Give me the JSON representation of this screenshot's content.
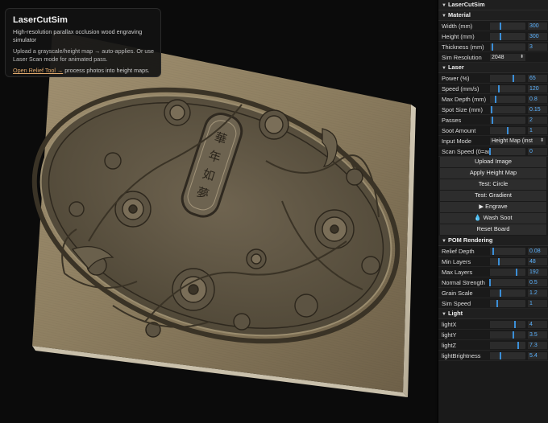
{
  "info": {
    "title": "LaserCutSim",
    "desc": "High-resolution parallax occlusion wood engraving simulator",
    "hint": "Upload a grayscale/height map → auto-applies. Or use Laser Scan mode for animated pass.",
    "link_label": "Open Relief Tool →",
    "link_suffix": " process photos into height maps."
  },
  "board": {
    "emblem_text": "華年如夢"
  },
  "gui": {
    "title": "LaserCutSim",
    "sections": [
      {
        "id": "material",
        "title": "Material",
        "rows": [
          {
            "label": "Width (mm)",
            "value": "300",
            "frac": 0.3
          },
          {
            "label": "Height (mm)",
            "value": "300",
            "frac": 0.3
          },
          {
            "label": "Thickness (mm)",
            "value": "3",
            "frac": 0.07
          },
          {
            "label": "Sim Resolution",
            "select": "2048"
          }
        ]
      },
      {
        "id": "laser",
        "title": "Laser",
        "rows": [
          {
            "label": "Power (%)",
            "value": "65",
            "frac": 0.65
          },
          {
            "label": "Speed (mm/s)",
            "value": "120",
            "frac": 0.24
          },
          {
            "label": "Max Depth (mm)",
            "value": "0.8",
            "frac": 0.15
          },
          {
            "label": "Spot Size (mm)",
            "value": "0.15",
            "frac": 0.05
          },
          {
            "label": "Passes",
            "value": "2",
            "frac": 0.06
          },
          {
            "label": "Soot Amount",
            "value": "1",
            "frac": 0.5
          },
          {
            "label": "Input Mode",
            "select": "Height Map (inst"
          },
          {
            "label": "Scan Speed (0=auto)",
            "value": "0",
            "frac": 0.0
          }
        ],
        "buttons": [
          "Upload Image",
          "Apply Height Map",
          "Test: Circle",
          "Test: Gradient",
          "▶ Engrave",
          "💧 Wash Soot",
          "Reset Board"
        ]
      },
      {
        "id": "pom",
        "title": "POM Rendering",
        "rows": [
          {
            "label": "Relief Depth",
            "value": "0.08",
            "frac": 0.08
          },
          {
            "label": "Min Layers",
            "value": "48",
            "frac": 0.25
          },
          {
            "label": "Max Layers",
            "value": "192",
            "frac": 0.75
          },
          {
            "label": "Normal Strength",
            "value": "0.5",
            "frac": 0.0
          },
          {
            "label": "Grain Scale",
            "value": "1.2",
            "frac": 0.3
          },
          {
            "label": "Sim Speed",
            "value": "1",
            "frac": 0.2
          }
        ]
      },
      {
        "id": "light",
        "title": "Light",
        "rows": [
          {
            "label": "lightX",
            "value": "4",
            "frac": 0.7
          },
          {
            "label": "lightY",
            "value": "3.5",
            "frac": 0.65
          },
          {
            "label": "lightZ",
            "value": "7.3",
            "frac": 0.8
          },
          {
            "label": "lightBrightness",
            "value": "5.4",
            "frac": 0.3
          }
        ]
      }
    ]
  },
  "colors": {
    "accent": "#3b8fd8",
    "number": "#5cb3ff",
    "link": "#e0a96d",
    "wood": "#8a7a5c"
  }
}
